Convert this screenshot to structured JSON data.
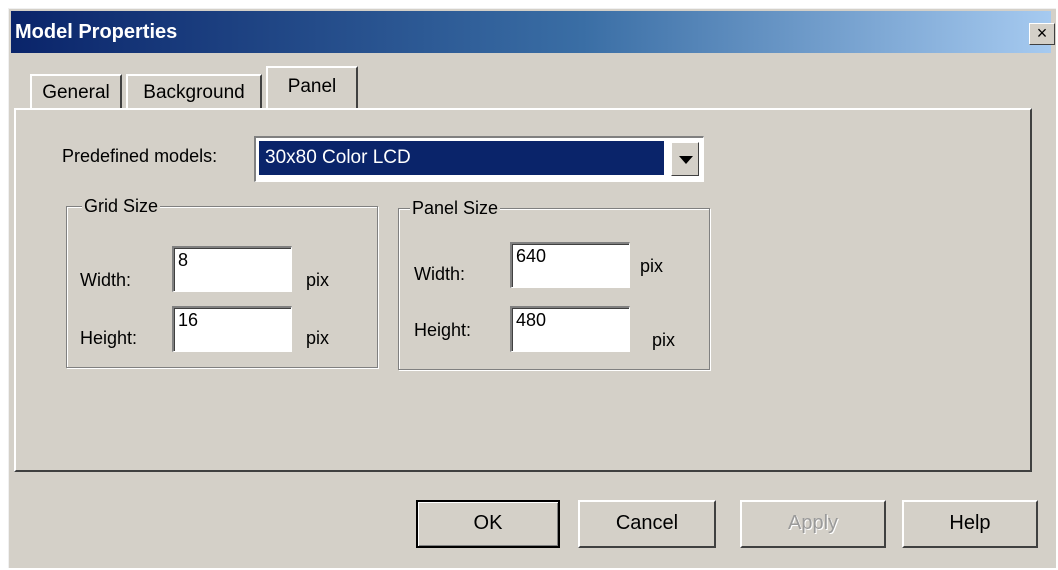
{
  "window": {
    "title": "Model Properties",
    "close_label": "×"
  },
  "tabs": [
    {
      "label": "General"
    },
    {
      "label": "Background"
    },
    {
      "label": "Panel"
    }
  ],
  "panel": {
    "predefined_label": "Predefined models:",
    "predefined_value": "30x80 Color LCD",
    "grid": {
      "title": "Grid Size",
      "width_label": "Width:",
      "width_value": "8",
      "height_label": "Height:",
      "height_value": "16",
      "unit": "pix"
    },
    "panelsize": {
      "title": "Panel Size",
      "width_label": "Width:",
      "width_value": "640",
      "height_label": "Height:",
      "height_value": "480",
      "unit": "pix"
    }
  },
  "buttons": {
    "ok": "OK",
    "cancel": "Cancel",
    "apply": "Apply",
    "help": "Help"
  }
}
